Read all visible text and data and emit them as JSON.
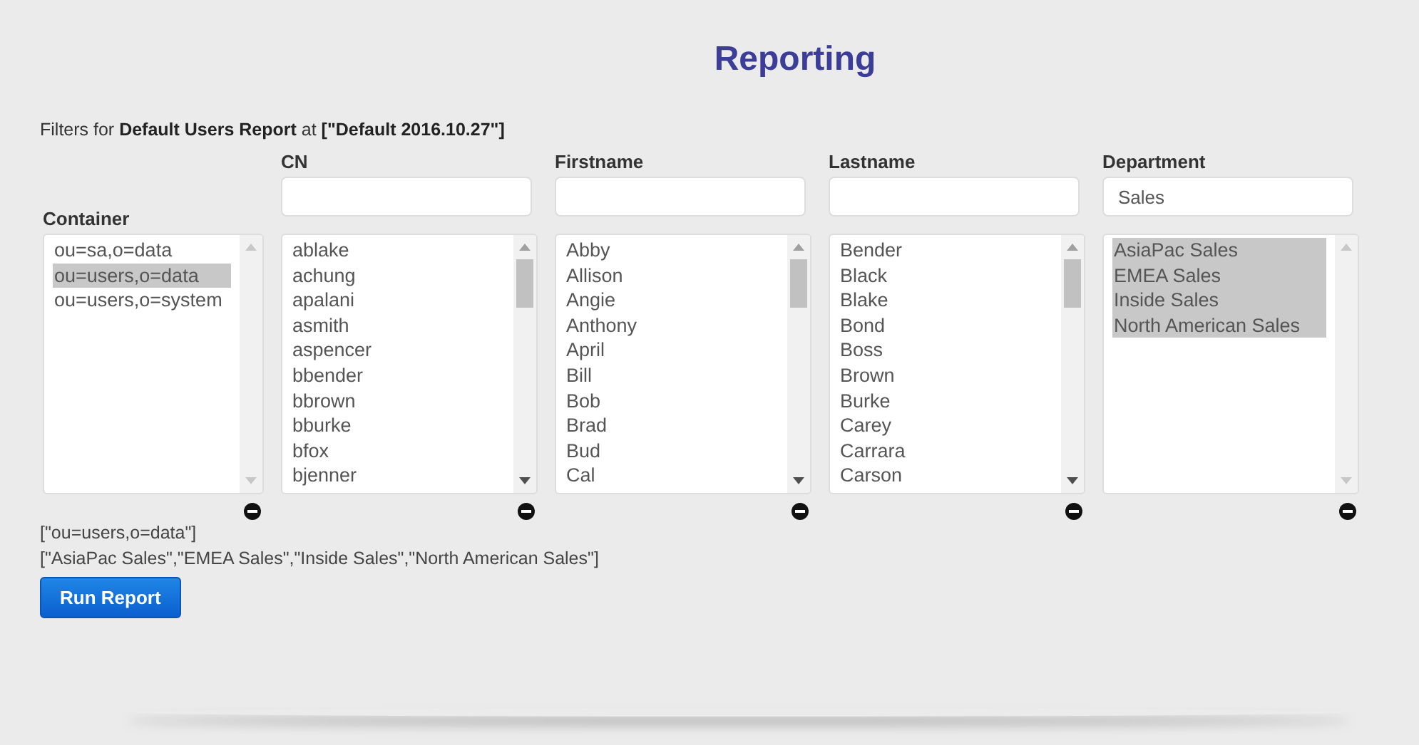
{
  "title": "Reporting",
  "filter_caption": "Filters for **Default Users Report** at **[\"Default 2016.10.27\"]**",
  "columns": [
    {
      "label": "Container",
      "has_filter": false,
      "scrollable": false,
      "items": [
        {
          "text": "ou=sa,o=data",
          "selected": false
        },
        {
          "text": "ou=users,o=data",
          "selected": true
        },
        {
          "text": "ou=users,o=system",
          "selected": false
        }
      ]
    },
    {
      "label": "CN",
      "has_filter": true,
      "scrollable": true,
      "items": [
        {
          "text": "ablake",
          "selected": false
        },
        {
          "text": "achung",
          "selected": false
        },
        {
          "text": "apalani",
          "selected": false
        },
        {
          "text": "asmith",
          "selected": false
        },
        {
          "text": "aspencer",
          "selected": false
        },
        {
          "text": "bbender",
          "selected": false
        },
        {
          "text": "bbrown",
          "selected": false
        },
        {
          "text": "bburke",
          "selected": false
        },
        {
          "text": "bfox",
          "selected": false
        },
        {
          "text": "bjenner",
          "selected": false
        }
      ]
    },
    {
      "label": "Firstname",
      "has_filter": true,
      "scrollable": true,
      "items": [
        {
          "text": "Abby",
          "selected": false
        },
        {
          "text": "Allison",
          "selected": false
        },
        {
          "text": "Angie",
          "selected": false
        },
        {
          "text": "Anthony",
          "selected": false
        },
        {
          "text": "April",
          "selected": false
        },
        {
          "text": "Bill",
          "selected": false
        },
        {
          "text": "Bob",
          "selected": false
        },
        {
          "text": "Brad",
          "selected": false
        },
        {
          "text": "Bud",
          "selected": false
        },
        {
          "text": "Cal",
          "selected": false
        }
      ]
    },
    {
      "label": "Lastname",
      "has_filter": true,
      "scrollable": true,
      "items": [
        {
          "text": "Bender",
          "selected": false
        },
        {
          "text": "Black",
          "selected": false
        },
        {
          "text": "Blake",
          "selected": false
        },
        {
          "text": "Bond",
          "selected": false
        },
        {
          "text": "Boss",
          "selected": false
        },
        {
          "text": "Brown",
          "selected": false
        },
        {
          "text": "Burke",
          "selected": false
        },
        {
          "text": "Carey",
          "selected": false
        },
        {
          "text": "Carrara",
          "selected": false
        },
        {
          "text": "Carson",
          "selected": false
        }
      ]
    },
    {
      "label": "Department",
      "has_filter": true,
      "filter_value": "Sales",
      "scrollable": false,
      "items": [
        {
          "text": "AsiaPac Sales",
          "selected": true
        },
        {
          "text": "EMEA Sales",
          "selected": true
        },
        {
          "text": "Inside Sales",
          "selected": true
        },
        {
          "text": "North American Sales",
          "selected": true
        }
      ]
    }
  ],
  "selections": [
    "[\"ou=users,o=data\"]",
    "[\"AsiaPac Sales\",\"EMEA Sales\",\"Inside Sales\",\"North American Sales\"]"
  ],
  "run_button": "Run Report"
}
